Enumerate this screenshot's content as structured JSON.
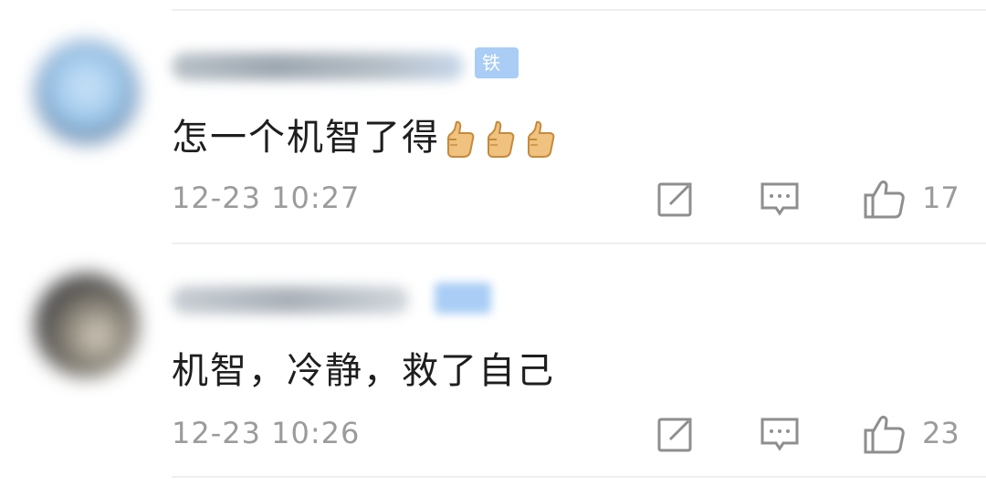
{
  "comments": [
    {
      "badge": "铁粉",
      "text": "怎一个机智了得",
      "emoji": [
        "thumbs-up",
        "thumbs-up",
        "thumbs-up"
      ],
      "time": "12-23 10:27",
      "likes": "17"
    },
    {
      "badge": "",
      "text": "机智，冷静，救了自己",
      "emoji": [],
      "time": "12-23 10:26",
      "likes": "23"
    }
  ],
  "icons": {
    "share": "share-icon",
    "reply": "comment-icon",
    "like": "thumbs-up-icon"
  },
  "colors": {
    "text": "#1e1e1e",
    "meta": "#9b9b9b",
    "badge": "#a9cdf5",
    "divider": "#efefef"
  }
}
